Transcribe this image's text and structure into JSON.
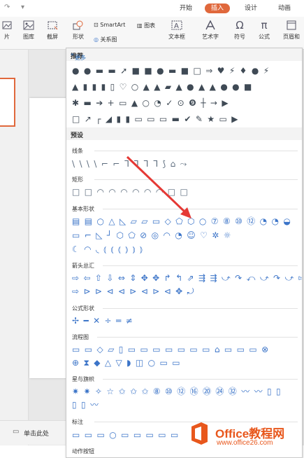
{
  "tabs": {
    "start": "开始",
    "insert": "插入",
    "design": "设计",
    "animation": "动画"
  },
  "ribbon": {
    "picture_cut": "片",
    "gallery": "图库",
    "screenshot": "截屏",
    "shape": "形状",
    "smartart": "SmartArt",
    "chart": "图表",
    "relationship": "关系图",
    "textbox": "文本框",
    "wordart": "艺术字",
    "symbol": "符号",
    "formula": "公式",
    "header": "页眉和"
  },
  "panel": {
    "recommend": "推荐",
    "more": "更多",
    "preset": "预设",
    "categories": {
      "lines": "线条",
      "rect": "矩形",
      "basic": "基本形状",
      "arrows": "箭头总汇",
      "formula": "公式形状",
      "flowchart": "流程图",
      "stars": "星与旗帜",
      "callouts": "标注",
      "actions": "动作按钮"
    },
    "rows": {
      "rec1": "●●▬▬➚■■●▬■□⇒♥⚡♦●⚡",
      "rec2": "▲▮▮▮▯♡○▲▲▰▲●▲▲●●■",
      "rec3": "✱▬➔+▭▲○◔✓⊙❾┼→▶",
      "rec4": "□↗┌◢▮▮▭▭▭▬✔✎★▭▶",
      "lines": "\\\\\\\\⌐⌐ᒣᒣᒣᒣ⟆⌂⤳",
      "rect": "□□◠◠◠◠◠◠□□",
      "basic1": "▤▤○△◺▱▱▭◇⬠⬡○⑦⑧⑩⑫◔◔◒",
      "basic2": "▭⌐◺┘⬡⬠⊘◎◠◔☺♡✲☼",
      "basic3": "☾◠◟⦅⦅⦅⦆⦆⦆",
      "arrows1": "⇨⇦⇧⇩⇔⇕✥✥↱↰⇗⇶⇶⤻↷⤺⤻↷⤻⇰",
      "arrows2": "⇨⊳⊳⊲⊲⊳⊲⊳⊲✥⤾",
      "formula": "✢━✕÷═≠",
      "flow1": "▭▭◇▱▯▭▭▭▭▭▭▭⌂▭▭▭⊗",
      "flow2": "⊕⧗◆△▽◗◫○▭▭",
      "stars1": "✷✷✧☆✩✩✩⑧⑩⑫⑯⑳㉔㉜〰〰▯▯",
      "stars2": "▯▯〰",
      "callouts": "▭▭▭○▭▭▭▭▭"
    }
  },
  "status": {
    "notes": "单击此处"
  },
  "watermark": {
    "title": "Office教程网",
    "url": "www.office26.com"
  }
}
